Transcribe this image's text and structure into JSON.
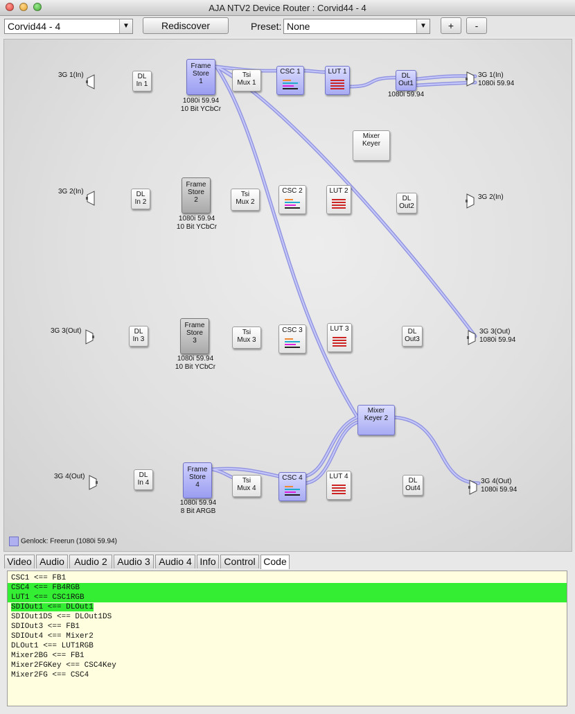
{
  "window": {
    "title": "AJA NTV2 Device Router : Corvid44 - 4"
  },
  "toolbar": {
    "device": "Corvid44 - 4",
    "rediscover": "Rediscover",
    "preset_label": "Preset:",
    "preset_value": "None",
    "plus": "+",
    "minus": "-"
  },
  "nodes": {
    "sdi1_in": "3G 1(In)",
    "sdi2_in": "3G 2(In)",
    "sdi3_out": "3G 3(Out)",
    "sdi4_out": "3G 4(Out)",
    "dlin1": "DL\nIn 1",
    "dlin2": "DL\nIn 2",
    "dlin3": "DL\nIn 3",
    "dlin4": "DL\nIn 4",
    "fs1": "Frame\nStore\n1",
    "fs2": "Frame\nStore\n2",
    "fs3": "Frame\nStore\n3",
    "fs4": "Frame\nStore\n4",
    "fs1_fmt": "1080i 59.94\n10 Bit YCbCr",
    "fs2_fmt": "1080i 59.94\n10 Bit YCbCr",
    "fs3_fmt": "1080i 59.94\n10 Bit YCbCr",
    "fs4_fmt": "1080i 59.94\n8 Bit ARGB",
    "tsi1": "Tsi\nMux 1",
    "tsi2": "Tsi\nMux 2",
    "tsi3": "Tsi\nMux 3",
    "tsi4": "Tsi\nMux 4",
    "csc1": "CSC 1",
    "csc2": "CSC 2",
    "csc3": "CSC 3",
    "csc4": "CSC 4",
    "lut1": "LUT 1",
    "lut2": "LUT 2",
    "lut3": "LUT 3",
    "lut4": "LUT 4",
    "dlout1": "DL\nOut1",
    "dlout2": "DL\nOut2",
    "dlout3": "DL\nOut3",
    "dlout4": "DL\nOut4",
    "dlout1_fmt": "1080i 59.94",
    "mixer1": "Mixer\nKeyer",
    "mixer2": "Mixer\nKeyer 2",
    "out1": "3G 1(In)\n1080i 59.94",
    "out2": "3G 2(In)",
    "out3": "3G 3(Out)\n1080i 59.94",
    "out4": "3G 4(Out)\n1080i 59.94"
  },
  "genlock": "Genlock: Freerun (1080i 59.94)",
  "tabs": [
    "Video",
    "Audio",
    "Audio 2",
    "Audio 3",
    "Audio 4",
    "Info",
    "Control",
    "Code"
  ],
  "active_tab": "Code",
  "code_lines": [
    "CSC1 <== FB1",
    "CSC4 <== FB4RGB",
    "LUT1 <== CSC1RGB",
    "SDIOut1 <== DLOut1",
    "SDIOut1DS <== DLOut1DS",
    "SDIOut3 <== FB1",
    "SDIOut4 <== Mixer2",
    "DLOut1 <== LUT1RGB",
    "Mixer2BG <== FB1",
    "Mixer2FGKey <== CSC4Key",
    "Mixer2FG <== CSC4"
  ],
  "colors": {
    "wire": "#a6a8ee",
    "selected_node": "#a8abf2",
    "highlight": "#33ee33",
    "code_bg": "#ffffe0"
  }
}
